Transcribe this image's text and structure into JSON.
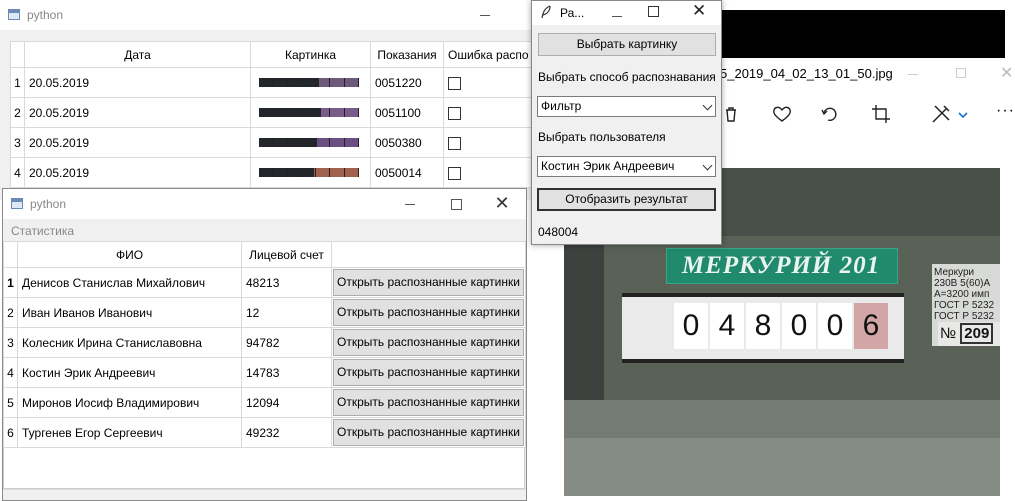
{
  "main_window": {
    "title": "python",
    "headers": [
      "Дата",
      "Картинка",
      "Показания",
      "Ошибка распо"
    ],
    "rows": [
      {
        "n": "1",
        "date": "20.05.2019",
        "reading": "0051220"
      },
      {
        "n": "2",
        "date": "20.05.2019",
        "reading": "0051100"
      },
      {
        "n": "3",
        "date": "20.05.2019",
        "reading": "0050380"
      },
      {
        "n": "4",
        "date": "20.05.2019",
        "reading": "0050014"
      }
    ]
  },
  "stats_window": {
    "title": "python",
    "menu_label": "Статистика",
    "headers": [
      "ФИО",
      "Лицевой счет"
    ],
    "button_label": "Открыть распознанные картинки",
    "rows": [
      {
        "n": "1",
        "name": "Денисов Станислав Михайлович",
        "account": "48213"
      },
      {
        "n": "2",
        "name": "Иван Иванов Иванович",
        "account": "12"
      },
      {
        "n": "3",
        "name": "Колесник Ирина Станиславовна",
        "account": "94782"
      },
      {
        "n": "4",
        "name": "Костин Эрик Андреевич",
        "account": "14783"
      },
      {
        "n": "5",
        "name": "Миронов Иосиф Владимирович",
        "account": "12094"
      },
      {
        "n": "6",
        "name": "Тургенев Егор Сергеевич",
        "account": "49232"
      }
    ]
  },
  "recog_window": {
    "title": "Ра...",
    "choose_image": "Выбрать картинку",
    "method_label": "Выбрать способ распознавания",
    "method_value": "Фильтр",
    "user_label": "Выбрать пользователя",
    "user_value": "Костин Эрик Андреевич",
    "show_result": "Отобразить результат",
    "result": "048004"
  },
  "photo_viewer": {
    "filename": "5_2019_04_02_13_01_50.jpg",
    "meter_brand": "МЕРКУРИЙ 201",
    "meter_digits": [
      "0",
      "4",
      "8",
      "0",
      "0",
      "6"
    ],
    "side_label_text": [
      "Меркури",
      "230В 5(60)А",
      "A=3200 имп",
      "ГОСТ Р 5232",
      "ГОСТ Р 5232"
    ],
    "serial_box_prefix": "№",
    "serial_box_value": "209"
  },
  "colors": {
    "brand_plate": "#1f8a6e",
    "photo_bg": "#5a6157"
  }
}
